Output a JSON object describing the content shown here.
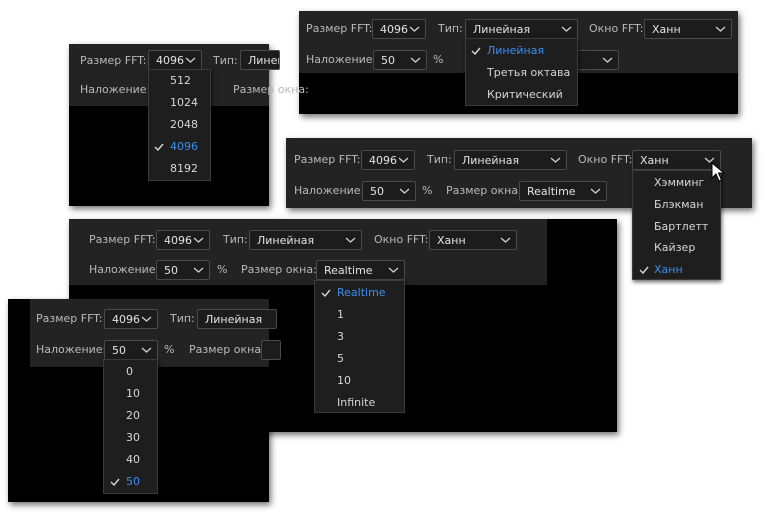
{
  "labels": {
    "fft_size": "Размер FFT:",
    "type": "Тип:",
    "window_fft": "Окно FFT:",
    "overlap": "Наложение:",
    "percent": "%",
    "window_size": "Размер окна:",
    "window_size_short": "Размер окна:"
  },
  "values": {
    "fft_size": "4096",
    "type": "Линейная",
    "window_fft": "Ханн",
    "overlap": "50",
    "window_size": "Realtime"
  },
  "menus": {
    "type": {
      "items": [
        "Линейная",
        "Третья октава",
        "Критический"
      ],
      "selected": "Линейная"
    },
    "fft_size": {
      "items": [
        "512",
        "1024",
        "2048",
        "4096",
        "8192"
      ],
      "selected": "4096"
    },
    "window_fft": {
      "items": [
        "Хэмминг",
        "Блэкман",
        "Бартлетт",
        "Кайзер",
        "Ханн"
      ],
      "selected": "Ханн"
    },
    "window_size": {
      "items": [
        "Realtime",
        "1",
        "3",
        "5",
        "10",
        "Infinite"
      ],
      "selected": "Realtime"
    },
    "overlap": {
      "items": [
        "0",
        "10",
        "20",
        "30",
        "40",
        "50"
      ],
      "selected": "50"
    }
  },
  "colors": {
    "accent": "#3d8ef0",
    "panel_bg": "#000000",
    "bar_bg": "#232323"
  },
  "icons": {
    "chevron": "chevron-down-icon",
    "check": "checkmark-icon",
    "cursor": "mouse-pointer-icon"
  }
}
